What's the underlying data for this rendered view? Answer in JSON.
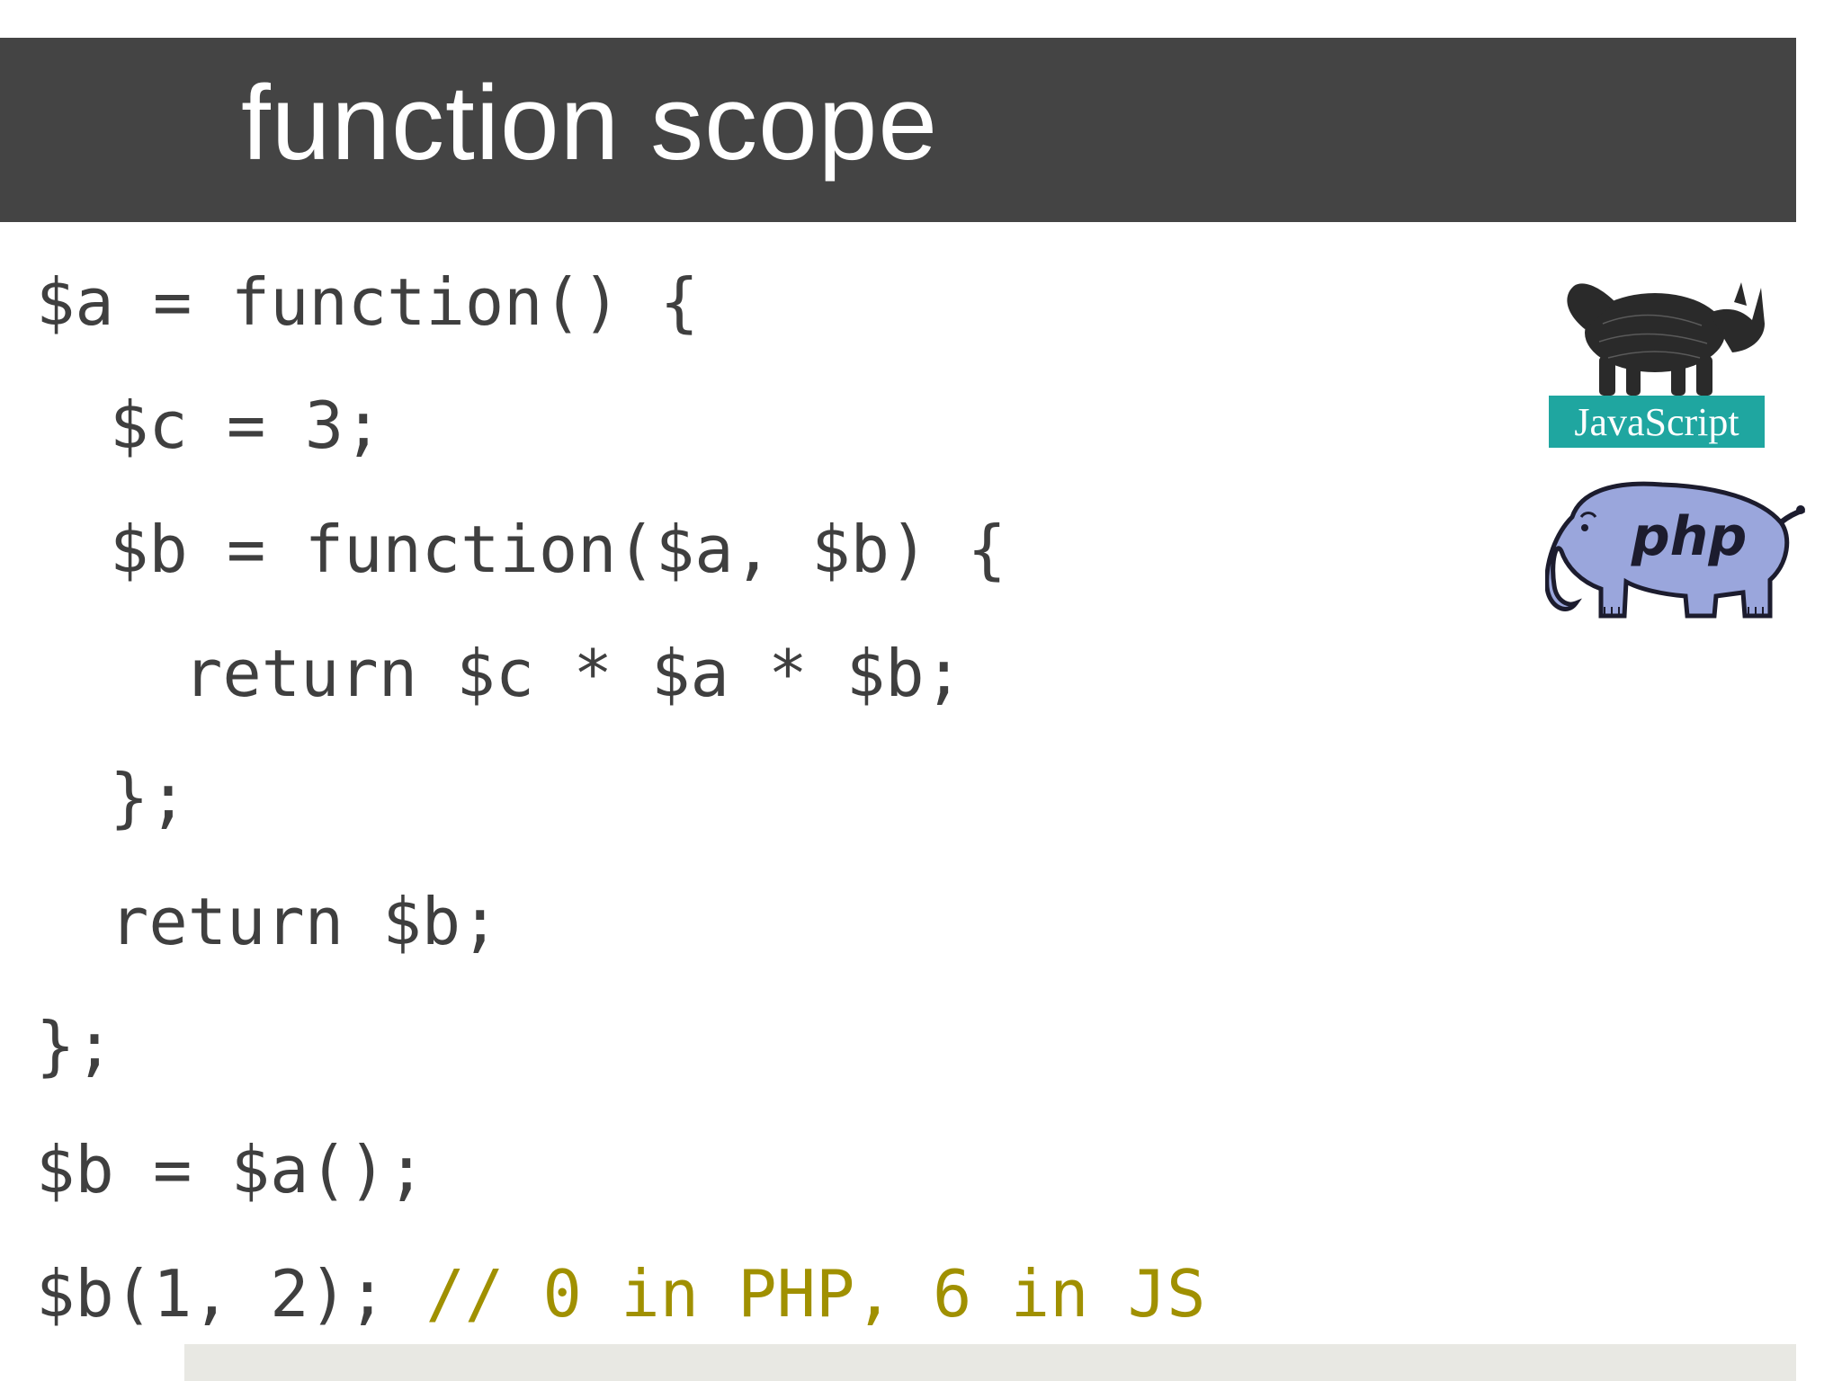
{
  "slide": {
    "title": "function scope"
  },
  "code": {
    "lines": [
      "$a = function() {",
      "$c = 3;",
      "$b = function($a, $b) {",
      "return $c * $a * $b;",
      "};",
      "return $b;",
      "};",
      "$b = $a();",
      "$b(1, 2);"
    ],
    "comment": "// 0 in PHP, 6 in JS"
  },
  "logos": {
    "javascript": {
      "label": "JavaScript",
      "icon": "rhinoceros-icon",
      "banner_color": "#1fa6a0"
    },
    "php": {
      "label": "php",
      "icon": "elephant-icon",
      "body_color": "#9aa6dc"
    }
  },
  "colors": {
    "title_bar": "#444444",
    "code_text": "#3f3f3f",
    "comment_text": "#a09000"
  }
}
